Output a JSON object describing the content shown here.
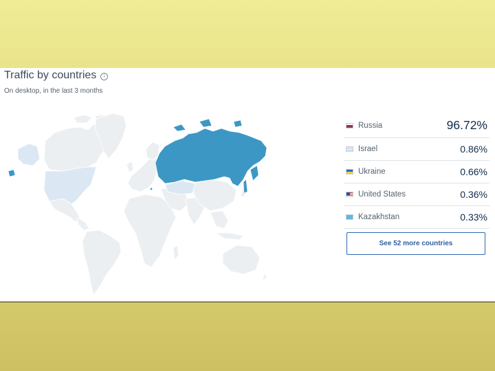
{
  "widget": {
    "title": "Traffic by countries",
    "info_icon": "info-icon",
    "subtitle": "On desktop, in the last 3 months",
    "see_more_label": "See 52 more countries"
  },
  "countries": [
    {
      "name": "Russia",
      "share": "96.72%",
      "flag": "ru"
    },
    {
      "name": "Israel",
      "share": "0.86%",
      "flag": "il"
    },
    {
      "name": "Ukraine",
      "share": "0.66%",
      "flag": "ua"
    },
    {
      "name": "United States",
      "share": "0.36%",
      "flag": "us"
    },
    {
      "name": "Kazakhstan",
      "share": "0.33%",
      "flag": "kz"
    }
  ],
  "colors": {
    "highlight_strong": "#3d97c4",
    "highlight_light": "#dbe8f3",
    "land": "#eceff1",
    "slide_background": "#e9e48c"
  }
}
